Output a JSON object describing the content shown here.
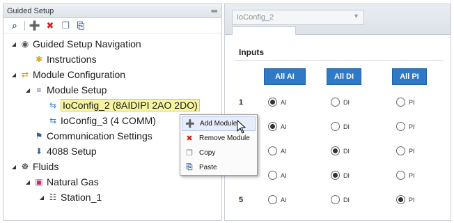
{
  "left_panel": {
    "title": "Guided Setup",
    "pin_glyph": "‖",
    "toolbar": [
      {
        "name": "search-icon",
        "glyph": "⌕",
        "color": "#4a6a8a"
      },
      {
        "name": "add-icon",
        "glyph": "➕",
        "color": "#2e9b3b"
      },
      {
        "name": "delete-icon",
        "glyph": "✖",
        "color": "#cc2222"
      },
      {
        "name": "copy-icon",
        "glyph": "❐",
        "color": "#6a7a8a"
      },
      {
        "name": "paste-icon",
        "glyph": "⎘",
        "color": "#3a6aaa"
      }
    ]
  },
  "tree": [
    {
      "label": "Guided Setup Navigation",
      "icon": "nav-icon",
      "glyph": "◉",
      "color": "#555555",
      "expander": "◢"
    },
    {
      "label": "Instructions",
      "icon": "lightbulb-icon",
      "glyph": "✱",
      "color": "#d8a72a",
      "expander": ""
    },
    {
      "label": "Module Configuration",
      "icon": "module-config-icon",
      "glyph": "⇄",
      "color": "#d89a20",
      "expander": "◢"
    },
    {
      "label": "Module Setup",
      "icon": "module-setup-icon",
      "glyph": "≡",
      "color": "#5a7090",
      "expander": "◢"
    },
    {
      "label": "IoConfig_2 (8AIDIPI 2AO 2DO)",
      "icon": "io-config-icon",
      "glyph": "⇆",
      "color": "#3a8ad0",
      "expander": "",
      "selected": true
    },
    {
      "label": "IoConfig_3 (4 COMM)",
      "icon": "io-config-icon",
      "glyph": "⇆",
      "color": "#3a8ad0",
      "expander": ""
    },
    {
      "label": "Communication Settings",
      "icon": "communication-icon",
      "glyph": "⚑",
      "color": "#3a5aa0",
      "expander": ""
    },
    {
      "label": "4088 Setup",
      "icon": "device-icon",
      "glyph": "⬇",
      "color": "#3a5aa0",
      "expander": ""
    },
    {
      "label": "Fluids",
      "icon": "fluids-icon",
      "glyph": "☸",
      "color": "#333333",
      "expander": "◢"
    },
    {
      "label": "Natural Gas",
      "icon": "natural-gas-icon",
      "glyph": "▣",
      "color": "#c0307a",
      "expander": "◢"
    },
    {
      "label": "Station_1",
      "icon": "station-icon",
      "glyph": "☷",
      "color": "#444444",
      "expander": "◢"
    }
  ],
  "context_menu": {
    "items": [
      {
        "label": "Add Module",
        "icon": "add-icon",
        "glyph": "➕",
        "color": "#2e9b3b",
        "hover": true
      },
      {
        "label": "Remove Module",
        "icon": "remove-icon",
        "glyph": "✖",
        "color": "#cc2222"
      },
      {
        "label": "Copy",
        "icon": "copy-icon",
        "glyph": "❐",
        "color": "#6a7a8a"
      },
      {
        "label": "Paste",
        "icon": "paste-icon",
        "glyph": "⎘",
        "color": "#3a6aaa"
      }
    ]
  },
  "right_panel": {
    "selector_value": "IoConfig_2",
    "selector_arrow": "▼",
    "section_title": "Inputs",
    "buttons": [
      "All AI",
      "All DI",
      "All PI"
    ],
    "button_color": "#2f79c6",
    "rows": [
      {
        "num": "1",
        "selected": "AI"
      },
      {
        "num": "",
        "selected": "AI"
      },
      {
        "num": "",
        "selected": "DI"
      },
      {
        "num": "",
        "selected": "DI"
      },
      {
        "num": "5",
        "selected": "PI"
      }
    ],
    "radio_labels": [
      "AI",
      "DI",
      "PI"
    ]
  }
}
